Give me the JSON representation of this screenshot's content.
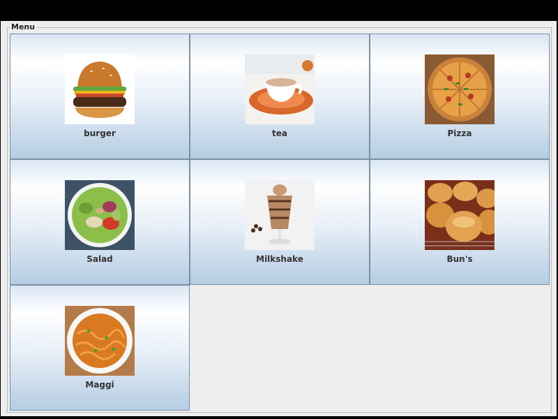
{
  "menu": {
    "title": "Menu",
    "items": [
      {
        "label": "burger",
        "image": "burger-image"
      },
      {
        "label": "tea",
        "image": "tea-image"
      },
      {
        "label": "Pizza",
        "image": "pizza-image"
      },
      {
        "label": "Salad",
        "image": "salad-image"
      },
      {
        "label": "Milkshake",
        "image": "milkshake-image"
      },
      {
        "label": "Bun's",
        "image": "buns-image"
      },
      {
        "label": "Maggi",
        "image": "maggi-image"
      }
    ]
  },
  "colors": {
    "item_border": "#7b8ea3",
    "item_gradient_top": "#ffffff",
    "item_gradient_bottom": "#b5cde3",
    "window_bg": "#eeeeee"
  }
}
